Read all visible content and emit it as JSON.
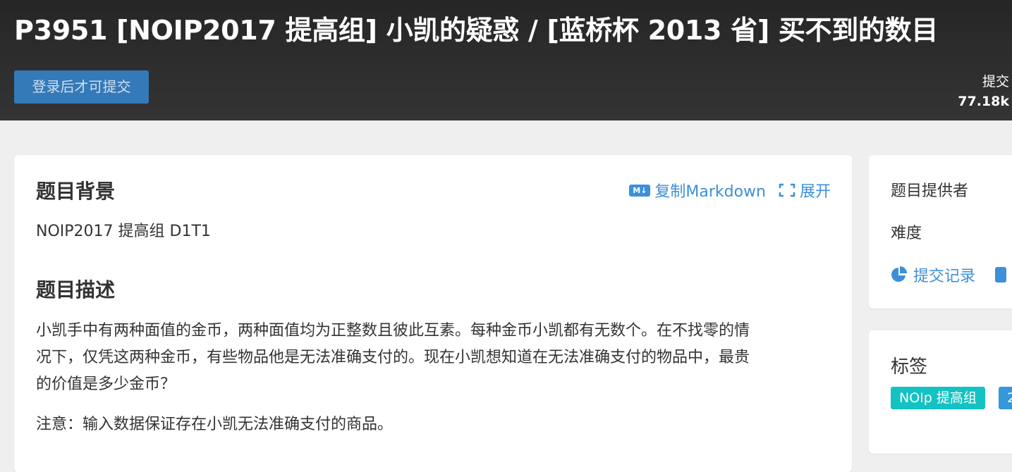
{
  "problem": {
    "title": "P3951 [NOIP2017 提高组] 小凯的疑惑 / [蓝桥杯 2013 省] 买不到的数目",
    "submit_label": "登录后才可提交",
    "stats": {
      "label": "提交",
      "value": "77.18k"
    }
  },
  "main": {
    "copy_markdown": "复制Markdown",
    "md_icon_text": "M↓",
    "expand": "展开",
    "background_heading": "题目背景",
    "background_text": "NOIP2017 提高组 D1T1",
    "description_heading": "题目描述",
    "description_lines": [
      "小凯手中有两种面值的金币，两种面值均为正整数且彼此互素。每种金币小凯都有无数个。在不找零的情",
      "况下，仅凭这两种金币，有些物品他是无法准确支付的。现在小凯想知道在无法准确支付的物品中，最贵",
      "的价值是多少金币？"
    ],
    "note": "注意：输入数据保证存在小凯无法准确支付的商品。"
  },
  "sidebar": {
    "provider_label": "题目提供者",
    "difficulty_label": "难度",
    "records_link": "提交记录",
    "tags_heading": "标签",
    "tags": [
      {
        "label": "NOIp 提高组",
        "color": "#13c2c2"
      },
      {
        "label": "2",
        "color": "#3498db"
      }
    ]
  },
  "colors": {
    "header_bg": "#2b2b2b",
    "accent": "#3d8fd9",
    "button": "#3479b8"
  }
}
